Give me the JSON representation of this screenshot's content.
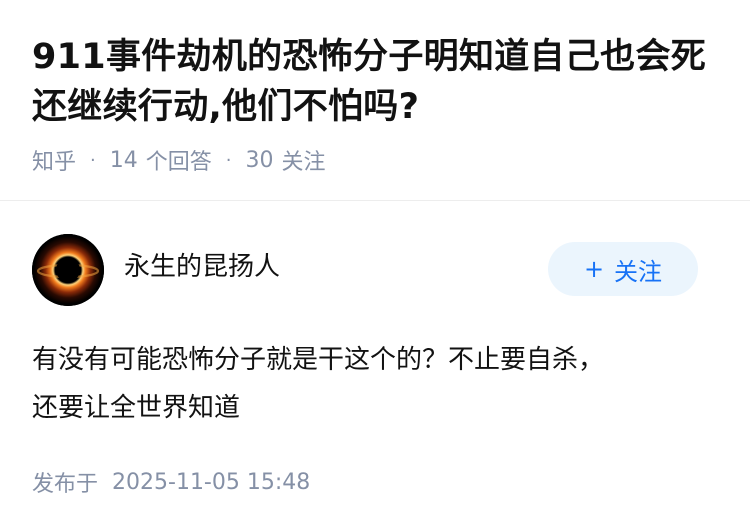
{
  "question": {
    "title": "911事件劫机的恐怖分子明知道自己也会死还继续行动,他们不怕吗?",
    "source": "知乎",
    "separator": "·",
    "answer_count": "14",
    "answer_label": "个回答",
    "follow_count": "30",
    "follow_label": "关注"
  },
  "answer": {
    "author": {
      "name": "永生的昆扬人",
      "avatar_icon": "black-hole-avatar"
    },
    "follow_button": {
      "plus": "+",
      "label": "关注"
    },
    "content_lines": [
      "有没有可能恐怖分子就是干这个的？不止要自杀，",
      "还要让全世界知道"
    ],
    "publish": {
      "label": "发布于",
      "datetime": "2025-11-05 15:48"
    }
  },
  "colors": {
    "text": "#121212",
    "meta": "#8590a6",
    "accent": "#1772f6",
    "follow_bg": "#ebf5fd"
  }
}
